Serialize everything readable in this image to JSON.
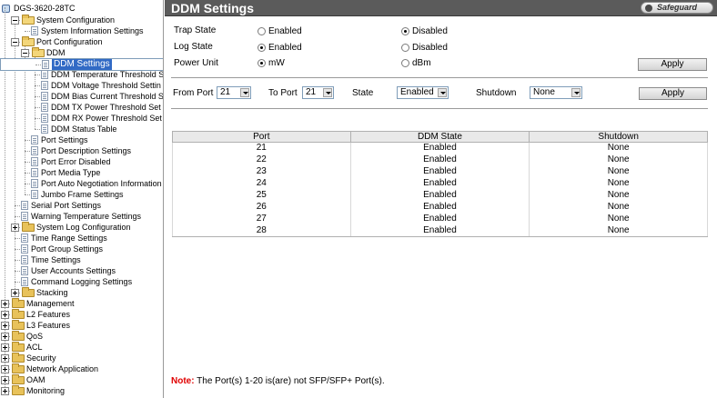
{
  "tree": {
    "root": "DGS-3620-28TC",
    "nodes": [
      {
        "label": "System Configuration",
        "type": "folder",
        "expanded": true
      },
      {
        "label": "System Information Settings",
        "type": "page"
      },
      {
        "label": "Port Configuration",
        "type": "folder",
        "expanded": true
      },
      {
        "label": "DDM",
        "type": "folder",
        "expanded": true
      },
      {
        "label": "DDM Settings",
        "type": "page",
        "selected": true
      },
      {
        "label": "DDM Temperature Threshold S",
        "type": "page"
      },
      {
        "label": "DDM Voltage Threshold Settin",
        "type": "page"
      },
      {
        "label": "DDM Bias Current Threshold S",
        "type": "page"
      },
      {
        "label": "DDM TX Power Threshold Set",
        "type": "page"
      },
      {
        "label": "DDM RX Power Threshold Set",
        "type": "page"
      },
      {
        "label": "DDM Status Table",
        "type": "page"
      },
      {
        "label": "Port Settings",
        "type": "page"
      },
      {
        "label": "Port Description Settings",
        "type": "page"
      },
      {
        "label": "Port Error Disabled",
        "type": "page"
      },
      {
        "label": "Port Media Type",
        "type": "page"
      },
      {
        "label": "Port Auto Negotiation Information",
        "type": "page"
      },
      {
        "label": "Jumbo Frame Settings",
        "type": "page"
      },
      {
        "label": "Serial Port Settings",
        "type": "page"
      },
      {
        "label": "Warning Temperature Settings",
        "type": "page"
      },
      {
        "label": "System Log Configuration",
        "type": "folder",
        "expanded": false
      },
      {
        "label": "Time Range Settings",
        "type": "page"
      },
      {
        "label": "Port Group Settings",
        "type": "page"
      },
      {
        "label": "Time Settings",
        "type": "page"
      },
      {
        "label": "User Accounts Settings",
        "type": "page"
      },
      {
        "label": "Command Logging Settings",
        "type": "page"
      },
      {
        "label": "Stacking",
        "type": "folder",
        "expanded": false
      },
      {
        "label": "Management",
        "type": "folder",
        "expanded": false
      },
      {
        "label": "L2 Features",
        "type": "folder",
        "expanded": false
      },
      {
        "label": "L3 Features",
        "type": "folder",
        "expanded": false
      },
      {
        "label": "QoS",
        "type": "folder",
        "expanded": false
      },
      {
        "label": "ACL",
        "type": "folder",
        "expanded": false
      },
      {
        "label": "Security",
        "type": "folder",
        "expanded": false
      },
      {
        "label": "Network Application",
        "type": "folder",
        "expanded": false
      },
      {
        "label": "OAM",
        "type": "folder",
        "expanded": false
      },
      {
        "label": "Monitoring",
        "type": "folder",
        "expanded": false
      }
    ]
  },
  "header": {
    "title": "DDM Settings",
    "safeguard": "Safeguard"
  },
  "form": {
    "trap_state_label": "Trap State",
    "log_state_label": "Log State",
    "power_unit_label": "Power Unit",
    "enabled": "Enabled",
    "disabled": "Disabled",
    "mw": "mW",
    "dbm": "dBm",
    "trap_state": "Disabled",
    "log_state": "Enabled",
    "power_unit": "mW",
    "apply": "Apply"
  },
  "port_form": {
    "from_port_label": "From Port",
    "from_port": "21",
    "to_port_label": "To Port",
    "to_port": "21",
    "state_label": "State",
    "state": "Enabled",
    "shutdown_label": "Shutdown",
    "shutdown": "None",
    "apply": "Apply"
  },
  "table": {
    "headers": [
      "Port",
      "DDM State",
      "Shutdown"
    ],
    "rows": [
      [
        "21",
        "Enabled",
        "None"
      ],
      [
        "22",
        "Enabled",
        "None"
      ],
      [
        "23",
        "Enabled",
        "None"
      ],
      [
        "24",
        "Enabled",
        "None"
      ],
      [
        "25",
        "Enabled",
        "None"
      ],
      [
        "26",
        "Enabled",
        "None"
      ],
      [
        "27",
        "Enabled",
        "None"
      ],
      [
        "28",
        "Enabled",
        "None"
      ]
    ]
  },
  "note": {
    "label": "Note:",
    "text": " The Port(s) 1-20 is(are) not SFP/SFP+ Port(s)."
  }
}
